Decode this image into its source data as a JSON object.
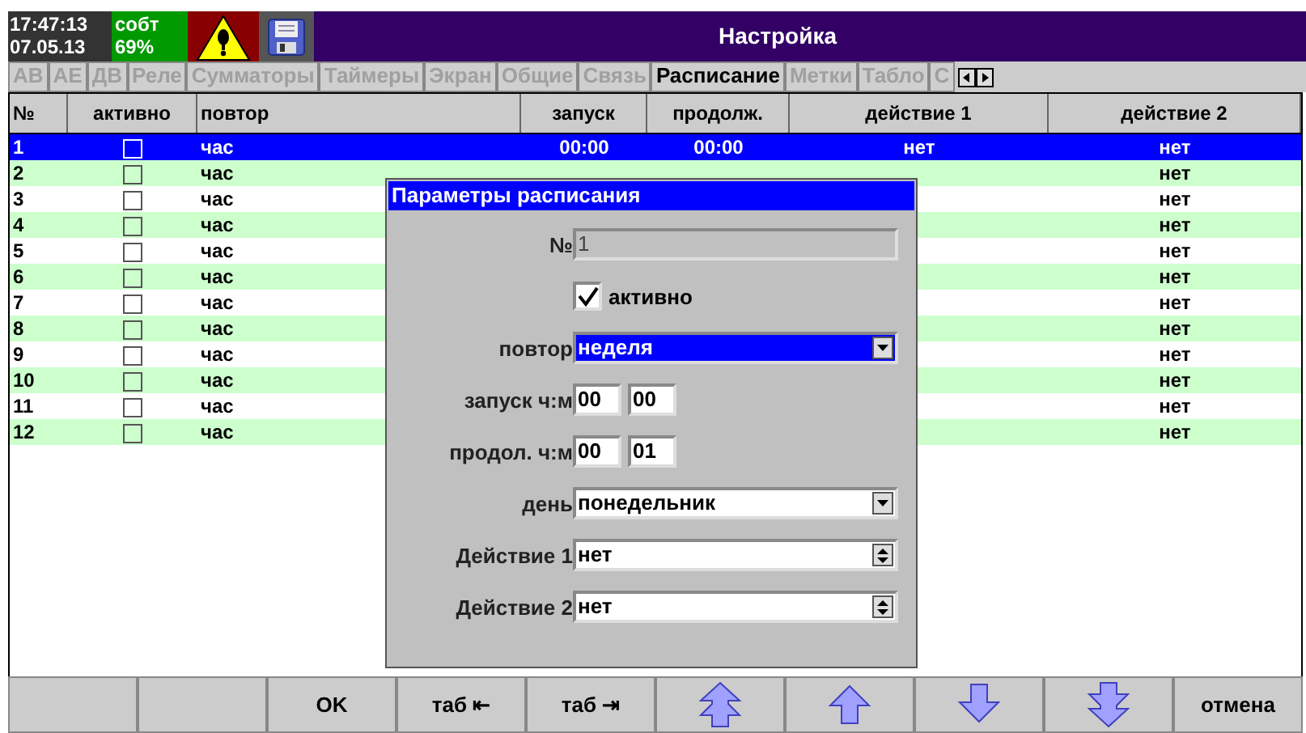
{
  "status": {
    "time": "17:47:13",
    "date": "07.05.13",
    "mode": "собт",
    "percent": "69%",
    "alarm": true
  },
  "window": {
    "title": "Настройка"
  },
  "tabs": [
    {
      "label": "АВ",
      "selected": false
    },
    {
      "label": "АЕ",
      "selected": false
    },
    {
      "label": "ДВ",
      "selected": false
    },
    {
      "label": "Реле",
      "selected": false
    },
    {
      "label": "Сумматоры",
      "selected": false
    },
    {
      "label": "Таймеры",
      "selected": false
    },
    {
      "label": "Экран",
      "selected": false
    },
    {
      "label": "Общие",
      "selected": false
    },
    {
      "label": "Связь",
      "selected": false
    },
    {
      "label": "Расписание",
      "selected": true
    },
    {
      "label": "Метки",
      "selected": false
    },
    {
      "label": "Табло",
      "selected": false
    },
    {
      "label": "С",
      "selected": false
    }
  ],
  "table": {
    "columns": [
      "№",
      "активно",
      "повтор",
      "запуск",
      "продолж.",
      "действие 1",
      "действие 2"
    ],
    "rows": [
      {
        "num": "1",
        "active": false,
        "repeat": "час",
        "start": "00:00",
        "duration": "00:00",
        "action1": "нет",
        "action2": "нет",
        "selected": true
      },
      {
        "num": "2",
        "active": false,
        "repeat": "час",
        "action2": "нет",
        "selected": false
      },
      {
        "num": "3",
        "active": false,
        "repeat": "час",
        "action2": "нет",
        "selected": false
      },
      {
        "num": "4",
        "active": false,
        "repeat": "час",
        "action2": "нет",
        "selected": false
      },
      {
        "num": "5",
        "active": false,
        "repeat": "час",
        "action2": "нет",
        "selected": false
      },
      {
        "num": "6",
        "active": false,
        "repeat": "час",
        "action2": "нет",
        "selected": false
      },
      {
        "num": "7",
        "active": false,
        "repeat": "час",
        "action2": "нет",
        "selected": false
      },
      {
        "num": "8",
        "active": false,
        "repeat": "час",
        "action2": "нет",
        "selected": false
      },
      {
        "num": "9",
        "active": false,
        "repeat": "час",
        "action2": "нет",
        "selected": false
      },
      {
        "num": "10",
        "active": false,
        "repeat": "час",
        "action2": "нет",
        "selected": false
      },
      {
        "num": "11",
        "active": false,
        "repeat": "час",
        "action2": "нет",
        "selected": false
      },
      {
        "num": "12",
        "active": false,
        "repeat": "час",
        "action2": "нет",
        "selected": false
      }
    ]
  },
  "dialog": {
    "title": "Параметры расписания",
    "fields": [
      {
        "kind": "readonly",
        "label": "№",
        "value": "1"
      },
      {
        "kind": "checkbox",
        "label": "активно",
        "checked": true
      },
      {
        "kind": "dropdown",
        "label": "повтор",
        "value": "неделя",
        "focused": true
      },
      {
        "kind": "time",
        "label": "запуск ч:м",
        "hours": "00",
        "minutes": "00"
      },
      {
        "kind": "time",
        "label": "продол. ч:м",
        "hours": "00",
        "minutes": "01"
      },
      {
        "kind": "dropdown",
        "label": "день",
        "value": "понедельник",
        "focused": false
      },
      {
        "kind": "spinner",
        "label": "Действие 1",
        "value": "нет"
      },
      {
        "kind": "spinner",
        "label": "Действие 2",
        "value": "нет"
      }
    ]
  },
  "buttons": [
    {
      "kind": "blank"
    },
    {
      "kind": "blank"
    },
    {
      "kind": "text",
      "label": "OK"
    },
    {
      "kind": "text",
      "label": "таб ⇤"
    },
    {
      "kind": "text",
      "label": "таб ⇥"
    },
    {
      "kind": "page-up"
    },
    {
      "kind": "up"
    },
    {
      "kind": "down"
    },
    {
      "kind": "page-down"
    },
    {
      "kind": "text",
      "label": "отмена"
    }
  ]
}
